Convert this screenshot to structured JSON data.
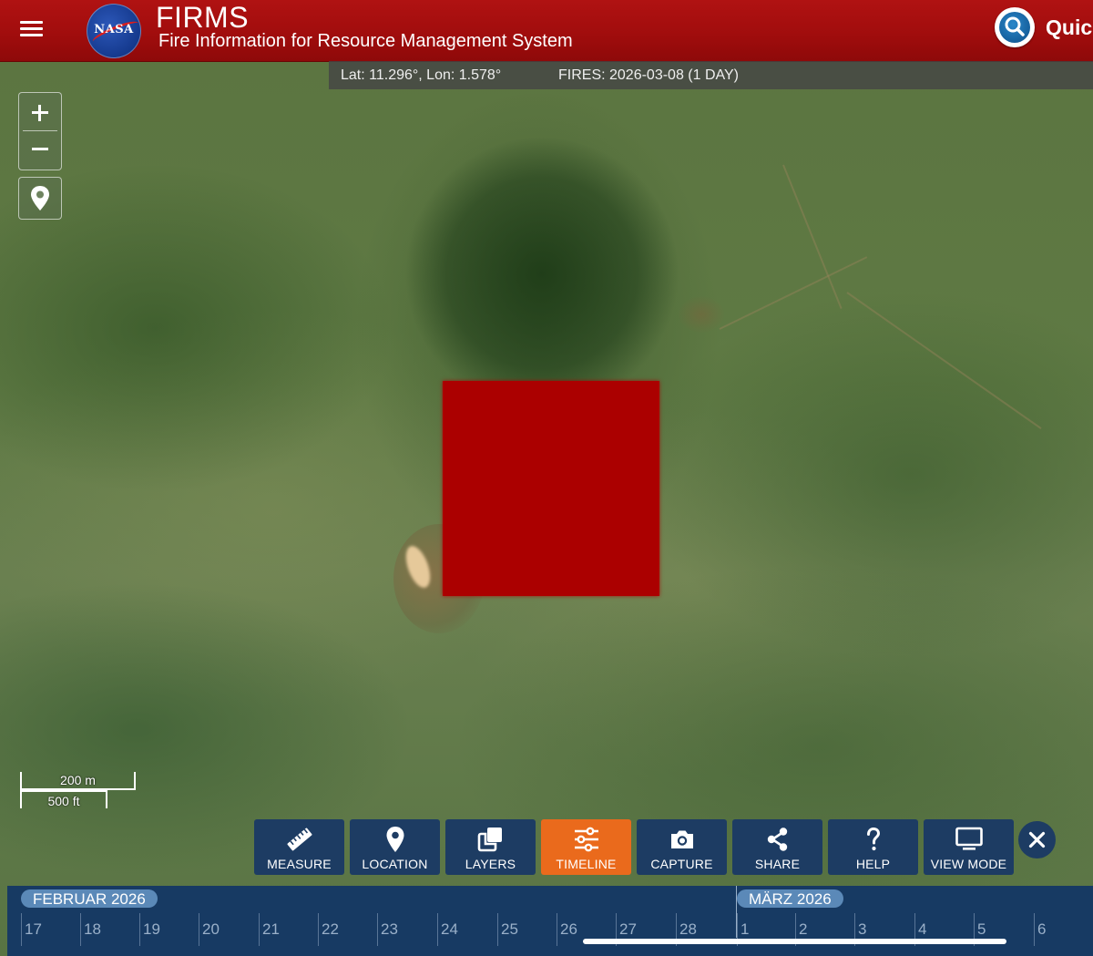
{
  "header": {
    "title": "FIRMS",
    "subtitle": "Fire Information for Resource Management System",
    "logo_text": "NASA",
    "quick_search_label": "Quick",
    "menu_icon": "hamburger-menu-icon",
    "colors": {
      "header_red": "#a10d0d"
    }
  },
  "status_bar": {
    "coords": "Lat: 11.296°, Lon: 1.578°",
    "fires": "FIRES: 2026-03-08 (1 DAY)"
  },
  "map": {
    "controls": {
      "zoom_in": "+",
      "zoom_out": "−",
      "location_icon": "map-pin-icon"
    },
    "scale": {
      "metric": "200 m",
      "imperial": "500 ft"
    },
    "fire_detection_color": "#ab0000"
  },
  "toolbar": {
    "buttons": [
      {
        "label": "MEASURE",
        "icon": "ruler-icon"
      },
      {
        "label": "LOCATION",
        "icon": "map-pin-icon"
      },
      {
        "label": "LAYERS",
        "icon": "layers-icon"
      },
      {
        "label": "TIMELINE",
        "icon": "sliders-icon",
        "active": true
      },
      {
        "label": "CAPTURE",
        "icon": "camera-icon"
      },
      {
        "label": "SHARE",
        "icon": "share-icon"
      },
      {
        "label": "HELP",
        "icon": "question-icon"
      },
      {
        "label": "VIEW MODE",
        "icon": "monitor-icon"
      }
    ],
    "close_icon": "close-icon",
    "colors": {
      "button_bg": "#1d3c63",
      "active_bg": "#ea6a1c"
    }
  },
  "timeline": {
    "months": [
      "FEBRUAR 2026",
      "MÄRZ 2026"
    ],
    "days": [
      "17",
      "18",
      "19",
      "20",
      "21",
      "22",
      "23",
      "24",
      "25",
      "26",
      "27",
      "28",
      "1",
      "2",
      "3",
      "4",
      "5",
      "6"
    ]
  }
}
